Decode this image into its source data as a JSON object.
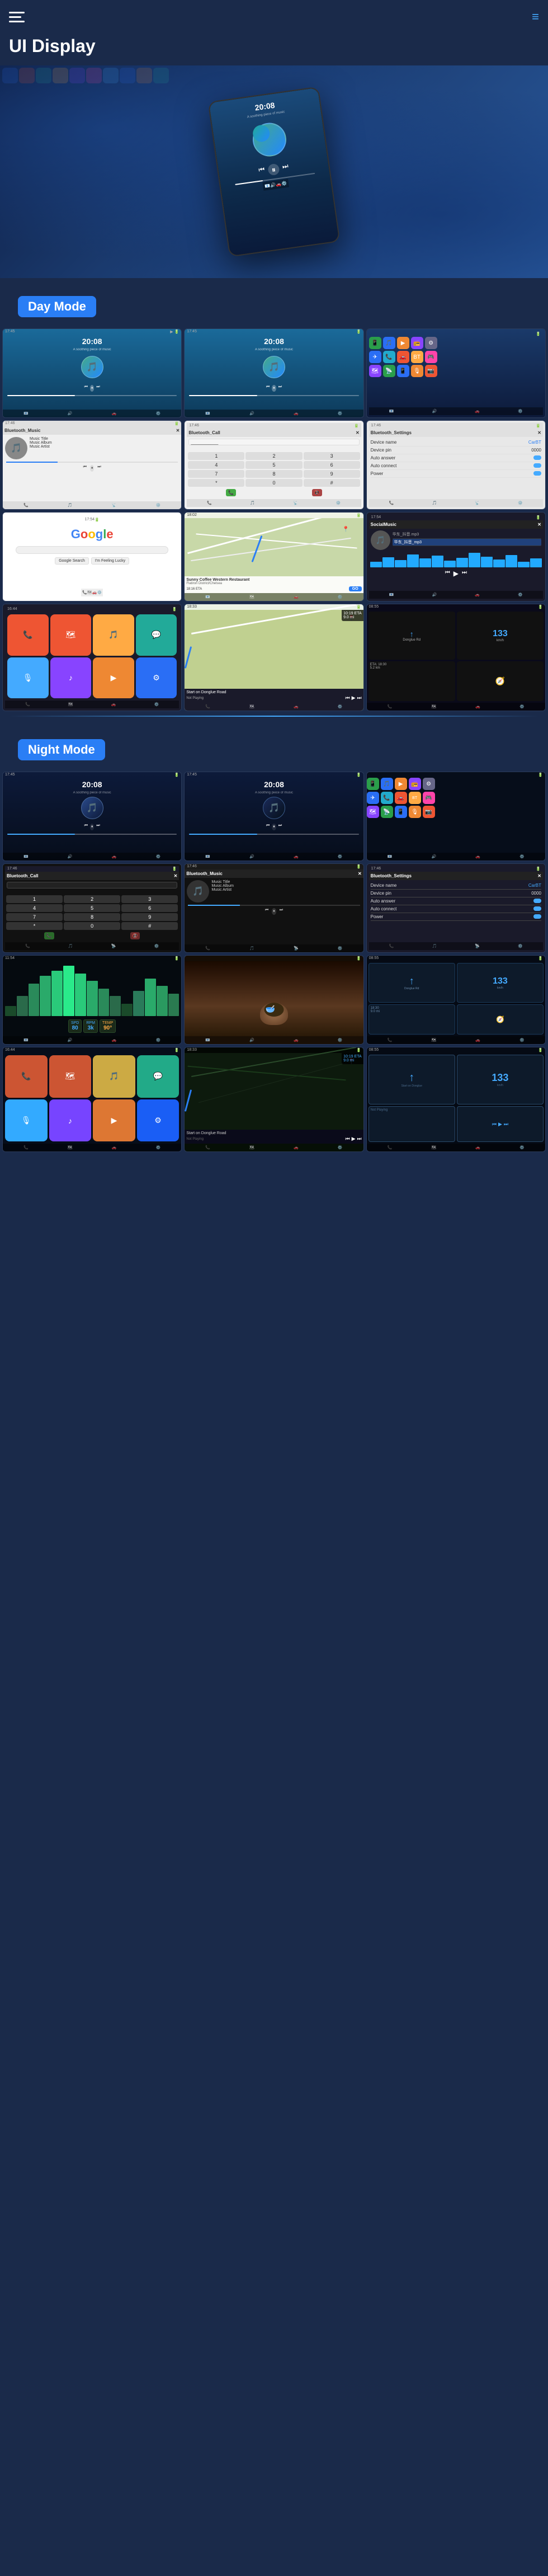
{
  "header": {
    "title": "UI Display",
    "menu_icon": "☰",
    "nav_icon": "≡"
  },
  "sections": {
    "day_mode": {
      "label": "Day Mode",
      "color": "#2a7ef5"
    },
    "night_mode": {
      "label": "Night Mode",
      "color": "#2a7ef5"
    }
  },
  "screens": {
    "hero_time": "20:08",
    "screen1_time": "20:08",
    "screen2_time": "20:08",
    "music_title": "Music Title",
    "music_album": "Music Album",
    "music_artist": "Music Artist",
    "bluetooth_music": "Bluetooth_Music",
    "bluetooth_call": "Bluetooth_Call",
    "bluetooth_settings": "Bluetooth_Settings",
    "device_name_label": "Device name",
    "device_name_val": "CarBT",
    "device_pin_label": "Device pin",
    "device_pin_val": "0000",
    "auto_answer_label": "Auto answer",
    "auto_connect_label": "Auto connect",
    "power_label": "Power",
    "google_text": "Google",
    "nav_restaurant": "Sunny Coffee Western Restaurant",
    "nav_address": "Flatiron District/Chelsea",
    "nav_eta": "10:19 ETA",
    "nav_distance": "9.0 mi",
    "nav_start": "Start on Donglue Road",
    "nav_not_playing": "Not Playing",
    "go_btn": "GO",
    "social_music_label": "SocialMusic",
    "track1": "华东_抖音.mp3",
    "track2": "华东_抖音_mp3",
    "speed_label": "133",
    "speed_unit": "km/h"
  }
}
